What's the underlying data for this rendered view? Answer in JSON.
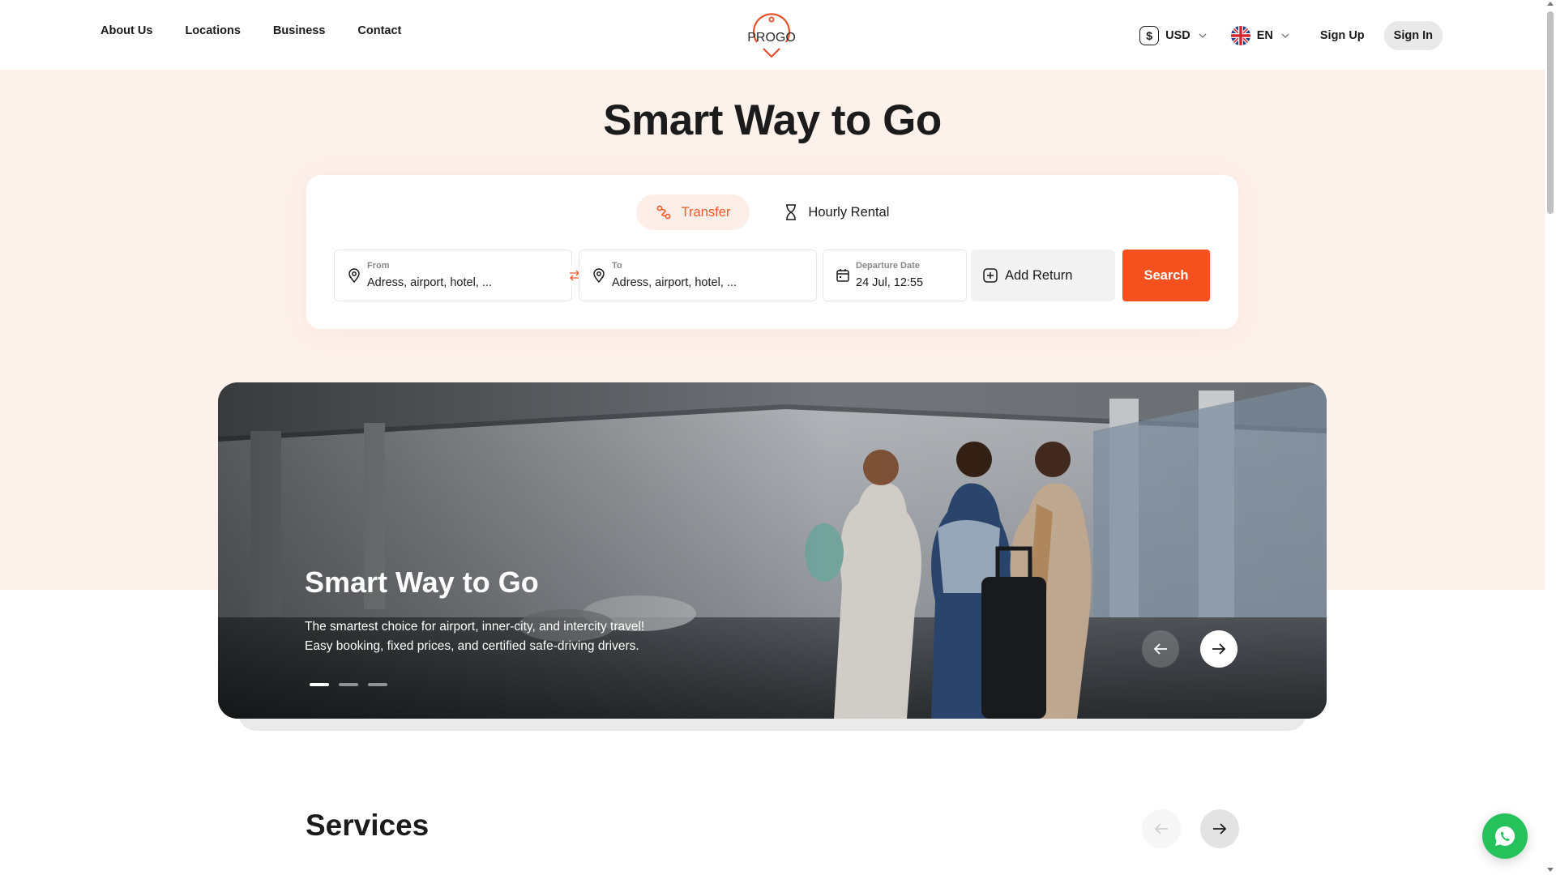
{
  "nav": {
    "links": [
      "About Us",
      "Locations",
      "Business",
      "Contact"
    ],
    "logo_text": "PROGO",
    "currency": "USD",
    "language": "EN",
    "sign_up": "Sign Up",
    "sign_in": "Sign In"
  },
  "hero": {
    "title": "Smart Way to Go"
  },
  "booking": {
    "tabs": [
      {
        "label": "Transfer",
        "active": true,
        "icon": "route-icon"
      },
      {
        "label": "Hourly Rental",
        "active": false,
        "icon": "hourglass-icon"
      }
    ],
    "from": {
      "label": "From",
      "placeholder": "Adress, airport, hotel, ..."
    },
    "to": {
      "label": "To",
      "placeholder": "Adress, airport, hotel, ..."
    },
    "departure": {
      "label": "Departure Date",
      "value": "24 Jul, 12:55"
    },
    "add_return": "Add Return",
    "search": "Search"
  },
  "slider": {
    "title": "Smart Way to Go",
    "text_line1": "The smartest choice for airport, inner-city, and intercity travel!",
    "text_line2": "Easy booking, fixed prices, and certified safe-driving drivers.",
    "slide_count": 3,
    "active_slide": 1
  },
  "services": {
    "title": "Services"
  },
  "colors": {
    "accent": "#f4511e",
    "hero_background": "#fdf1ec",
    "whatsapp": "#25c25b"
  }
}
